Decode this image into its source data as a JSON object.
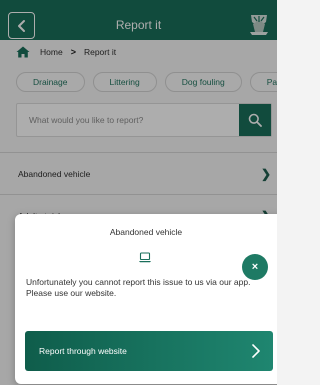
{
  "header": {
    "title": "Report it"
  },
  "breadcrumb": {
    "home": "Home",
    "separator": ">",
    "current": "Report it"
  },
  "categories": [
    "Drainage",
    "Littering",
    "Dog fouling",
    "Paveme"
  ],
  "search": {
    "placeholder": "What would you like to report?"
  },
  "list": {
    "items": [
      {
        "label": "Abandoned vehicle"
      },
      {
        "label": "Adult at risk"
      }
    ]
  },
  "modal": {
    "title": "Abandoned vehicle",
    "message": "Unfortunately you cannot report this issue to us via our app. Please use our website.",
    "button_label": "Report through website",
    "close_symbol": "×"
  },
  "colors": {
    "brand": "#1a6f5b",
    "accent": "#1e7a64"
  },
  "icons": [
    "back-icon",
    "crest-icon",
    "home-icon",
    "search-icon",
    "chevron-right-icon",
    "laptop-icon",
    "close-icon"
  ]
}
